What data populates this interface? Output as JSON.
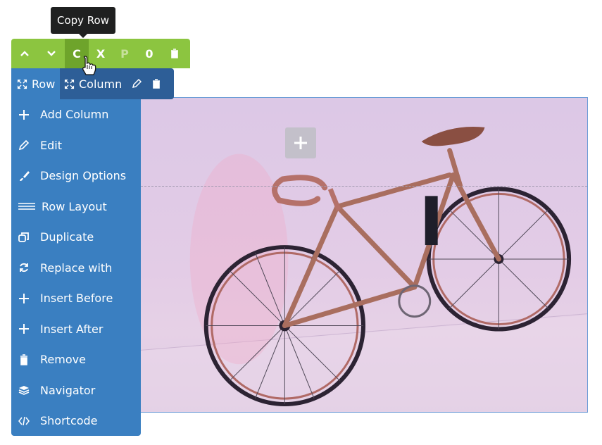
{
  "tooltip": {
    "text": "Copy Row"
  },
  "row_toolbar": {
    "move_up_icon": "chevron-up",
    "move_down_icon": "chevron-down",
    "copy_label": "C",
    "cut_label": "X",
    "paste_label": "P",
    "count_label": "0",
    "delete_icon": "trash",
    "colors": {
      "background": "#8cc540",
      "active": "#6ea42b"
    }
  },
  "tabs": {
    "row_label": "Row",
    "column_label": "Column",
    "colors": {
      "row": "#3a7fc1",
      "column": "#2d5e97"
    }
  },
  "menu": {
    "items": [
      {
        "label": "Add Column",
        "icon": "plus"
      },
      {
        "label": "Edit",
        "icon": "pencil"
      },
      {
        "label": "Design Options",
        "icon": "brush"
      },
      {
        "label": "Row Layout",
        "icon": "lines"
      },
      {
        "label": "Duplicate",
        "icon": "duplicate"
      },
      {
        "label": "Replace with",
        "icon": "refresh"
      },
      {
        "label": "Insert Before",
        "icon": "plus"
      },
      {
        "label": "Insert After",
        "icon": "plus"
      },
      {
        "label": "Remove",
        "icon": "trash"
      },
      {
        "label": "Navigator",
        "icon": "layers"
      },
      {
        "label": "Shortcode",
        "icon": "code"
      }
    ]
  },
  "canvas": {
    "add_icon": "plus",
    "image_subject": "bicycle"
  }
}
